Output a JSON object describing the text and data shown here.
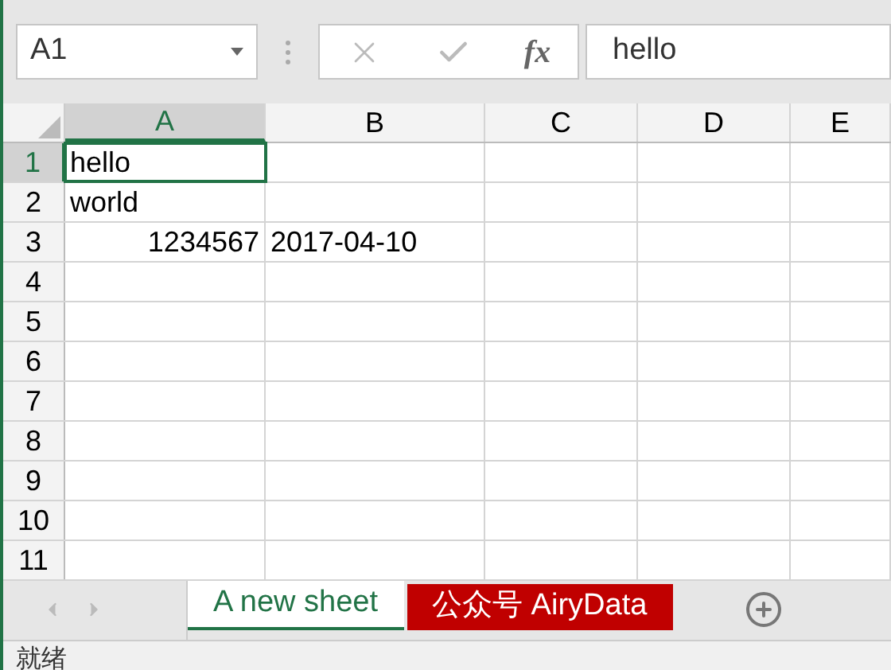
{
  "name_box": {
    "value": "A1"
  },
  "formula_bar": {
    "function_label": "fx",
    "value": "hello"
  },
  "columns": [
    {
      "label": "A",
      "selected": true
    },
    {
      "label": "B",
      "selected": false
    },
    {
      "label": "C",
      "selected": false
    },
    {
      "label": "D",
      "selected": false
    },
    {
      "label": "E",
      "selected": false
    }
  ],
  "rows": [
    {
      "label": "1",
      "selected": true,
      "cells": [
        {
          "value": "hello",
          "kind": "text",
          "selected": true
        }
      ]
    },
    {
      "label": "2",
      "selected": false,
      "cells": [
        {
          "value": "world",
          "kind": "text",
          "selected": false
        }
      ]
    },
    {
      "label": "3",
      "selected": false,
      "cells": [
        {
          "value": "1234567",
          "kind": "number",
          "selected": false
        },
        {
          "value": "2017-04-10",
          "kind": "text",
          "selected": false
        }
      ]
    },
    {
      "label": "4",
      "selected": false,
      "cells": []
    },
    {
      "label": "5",
      "selected": false,
      "cells": []
    },
    {
      "label": "6",
      "selected": false,
      "cells": []
    },
    {
      "label": "7",
      "selected": false,
      "cells": []
    },
    {
      "label": "8",
      "selected": false,
      "cells": []
    },
    {
      "label": "9",
      "selected": false,
      "cells": []
    },
    {
      "label": "10",
      "selected": false,
      "cells": []
    },
    {
      "label": "11",
      "selected": false,
      "cells": []
    }
  ],
  "sheet_tabs": [
    {
      "label": "A new sheet",
      "selected": true
    },
    {
      "label": "公众号 AiryData",
      "selected": false,
      "color": "#c00000"
    }
  ],
  "status_bar": {
    "text": "就绪"
  }
}
